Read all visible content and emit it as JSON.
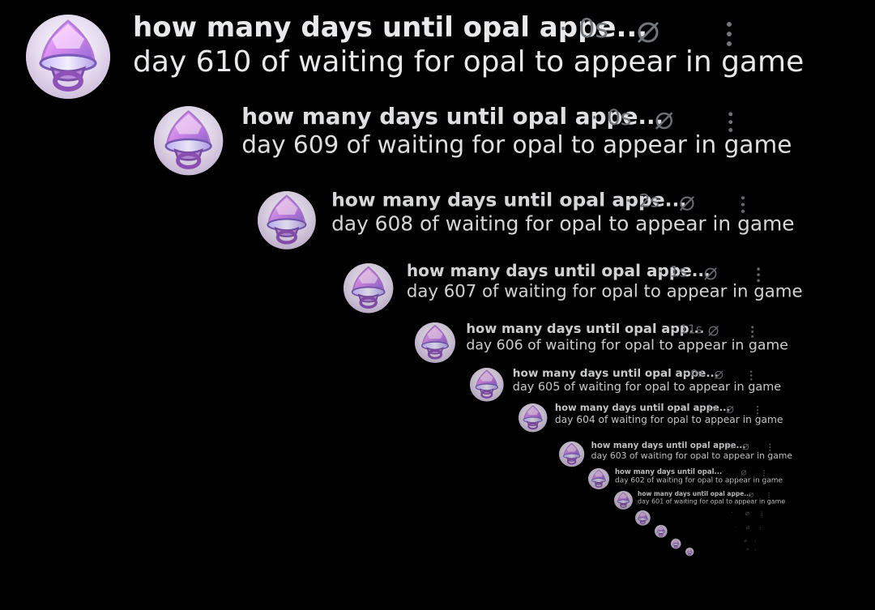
{
  "posts": [
    {
      "name": "how many days until opal appe...",
      "time": "0s",
      "text": "day 610 of waiting for opal to appear in game"
    },
    {
      "name": "how many days until opal appe...",
      "time": "0s",
      "text": "day 609 of waiting for opal to appear in game"
    },
    {
      "name": "how many days until opal appe...",
      "time": "2s",
      "text": "day 608 of waiting for opal to appear in game"
    },
    {
      "name": "how many days until opal appe...",
      "time": "1s",
      "text": "day 607 of waiting for opal to appear in game"
    },
    {
      "name": "how many days until opal app...",
      "time": "11s",
      "text": "day 606 of waiting for opal to appear in game"
    },
    {
      "name": "how many days until opal appe...",
      "time": "0s",
      "text": "day 605 of waiting for opal to appear in game"
    },
    {
      "name": "how many days until opal appe...",
      "time": "1s",
      "text": "day 604 of waiting for opal to appear in game"
    },
    {
      "name": "how many days until opal appe...",
      "time": "1s",
      "text": "day 603 of waiting for opal to appear in game"
    },
    {
      "name": "how many days until opal...",
      "time": "",
      "text": "day 602 of waiting for opal to appear in game"
    },
    {
      "name": "how many days until opal appe...",
      "time": "",
      "text": "day 601 of waiting for opal to appear in game"
    },
    {
      "name": "",
      "time": "",
      "text": ""
    },
    {
      "name": "",
      "time": "",
      "text": ""
    },
    {
      "name": "",
      "time": "",
      "text": ""
    },
    {
      "name": "",
      "time": "",
      "text": ""
    }
  ],
  "separator": "·",
  "colors": {
    "background": "#000000",
    "primary_text": "#e7e9ea",
    "secondary_text": "#71767b",
    "avatar_purple": "#b98ad6",
    "avatar_light": "#ddd3ea"
  },
  "icons": {
    "avatar": "opal-pacifier-avatar",
    "grok": "slashed-circle-icon",
    "more": "three-dots-vertical-icon"
  }
}
